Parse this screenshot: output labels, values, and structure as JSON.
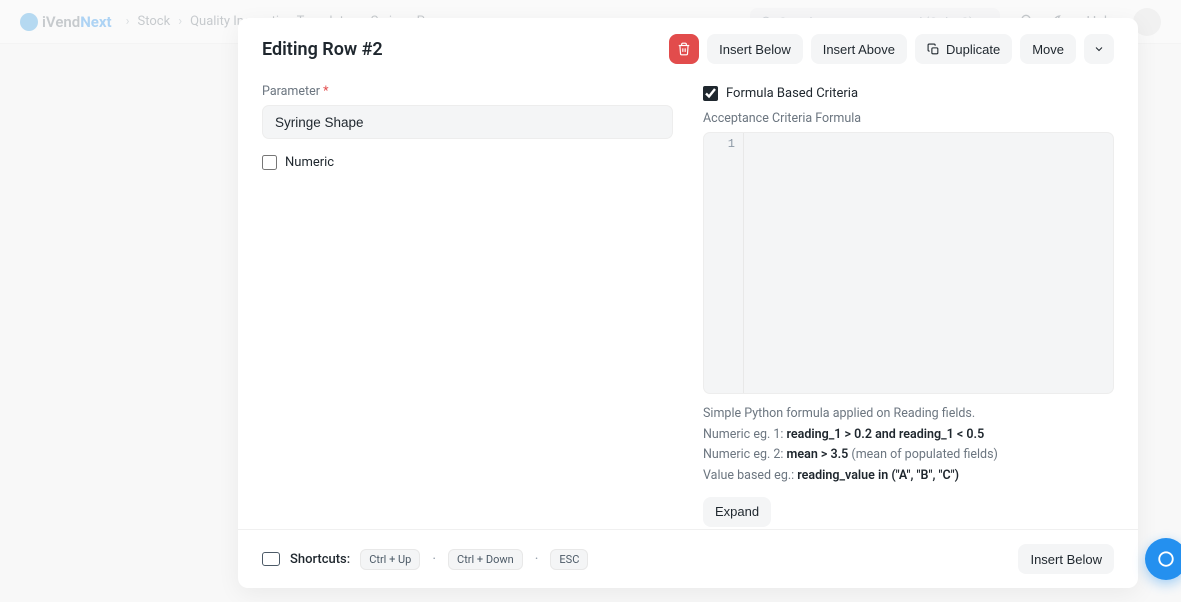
{
  "topbar": {
    "logo_part1": "iVend",
    "logo_part2": "Next",
    "breadcrumb": [
      "Stock",
      "Quality Inspection Template",
      "Syringe P..."
    ],
    "search_placeholder": "Search or type a command (Ctrl + G)",
    "help_label": "Help"
  },
  "modal": {
    "title": "Editing Row #2",
    "actions": {
      "delete_title": "Delete",
      "insert_below": "Insert Below",
      "insert_above": "Insert Above",
      "duplicate": "Duplicate",
      "move": "Move"
    },
    "left": {
      "parameter_label": "Parameter",
      "parameter_value": "Syringe Shape",
      "numeric_label": "Numeric",
      "numeric_checked": false
    },
    "right": {
      "formula_based_label": "Formula Based Criteria",
      "formula_based_checked": true,
      "acceptance_label": "Acceptance Criteria Formula",
      "code_line_number": "1",
      "code_value": "",
      "help": {
        "line1": "Simple Python formula applied on Reading fields.",
        "line2_prefix": "Numeric eg. 1: ",
        "line2_bold": "reading_1 > 0.2 and reading_1 < 0.5",
        "line3_prefix": "Numeric eg. 2: ",
        "line3_bold": "mean > 3.5",
        "line3_suffix": " (mean of populated fields)",
        "line4_prefix": "Value based eg.: ",
        "line4_bold": " reading_value in (\"A\", \"B\", \"C\")"
      },
      "expand_label": "Expand"
    },
    "footer": {
      "shortcuts_label": "Shortcuts:",
      "kbd1": "Ctrl + Up",
      "kbd2": "Ctrl + Down",
      "kbd3": "ESC",
      "insert_below": "Insert Below"
    }
  }
}
